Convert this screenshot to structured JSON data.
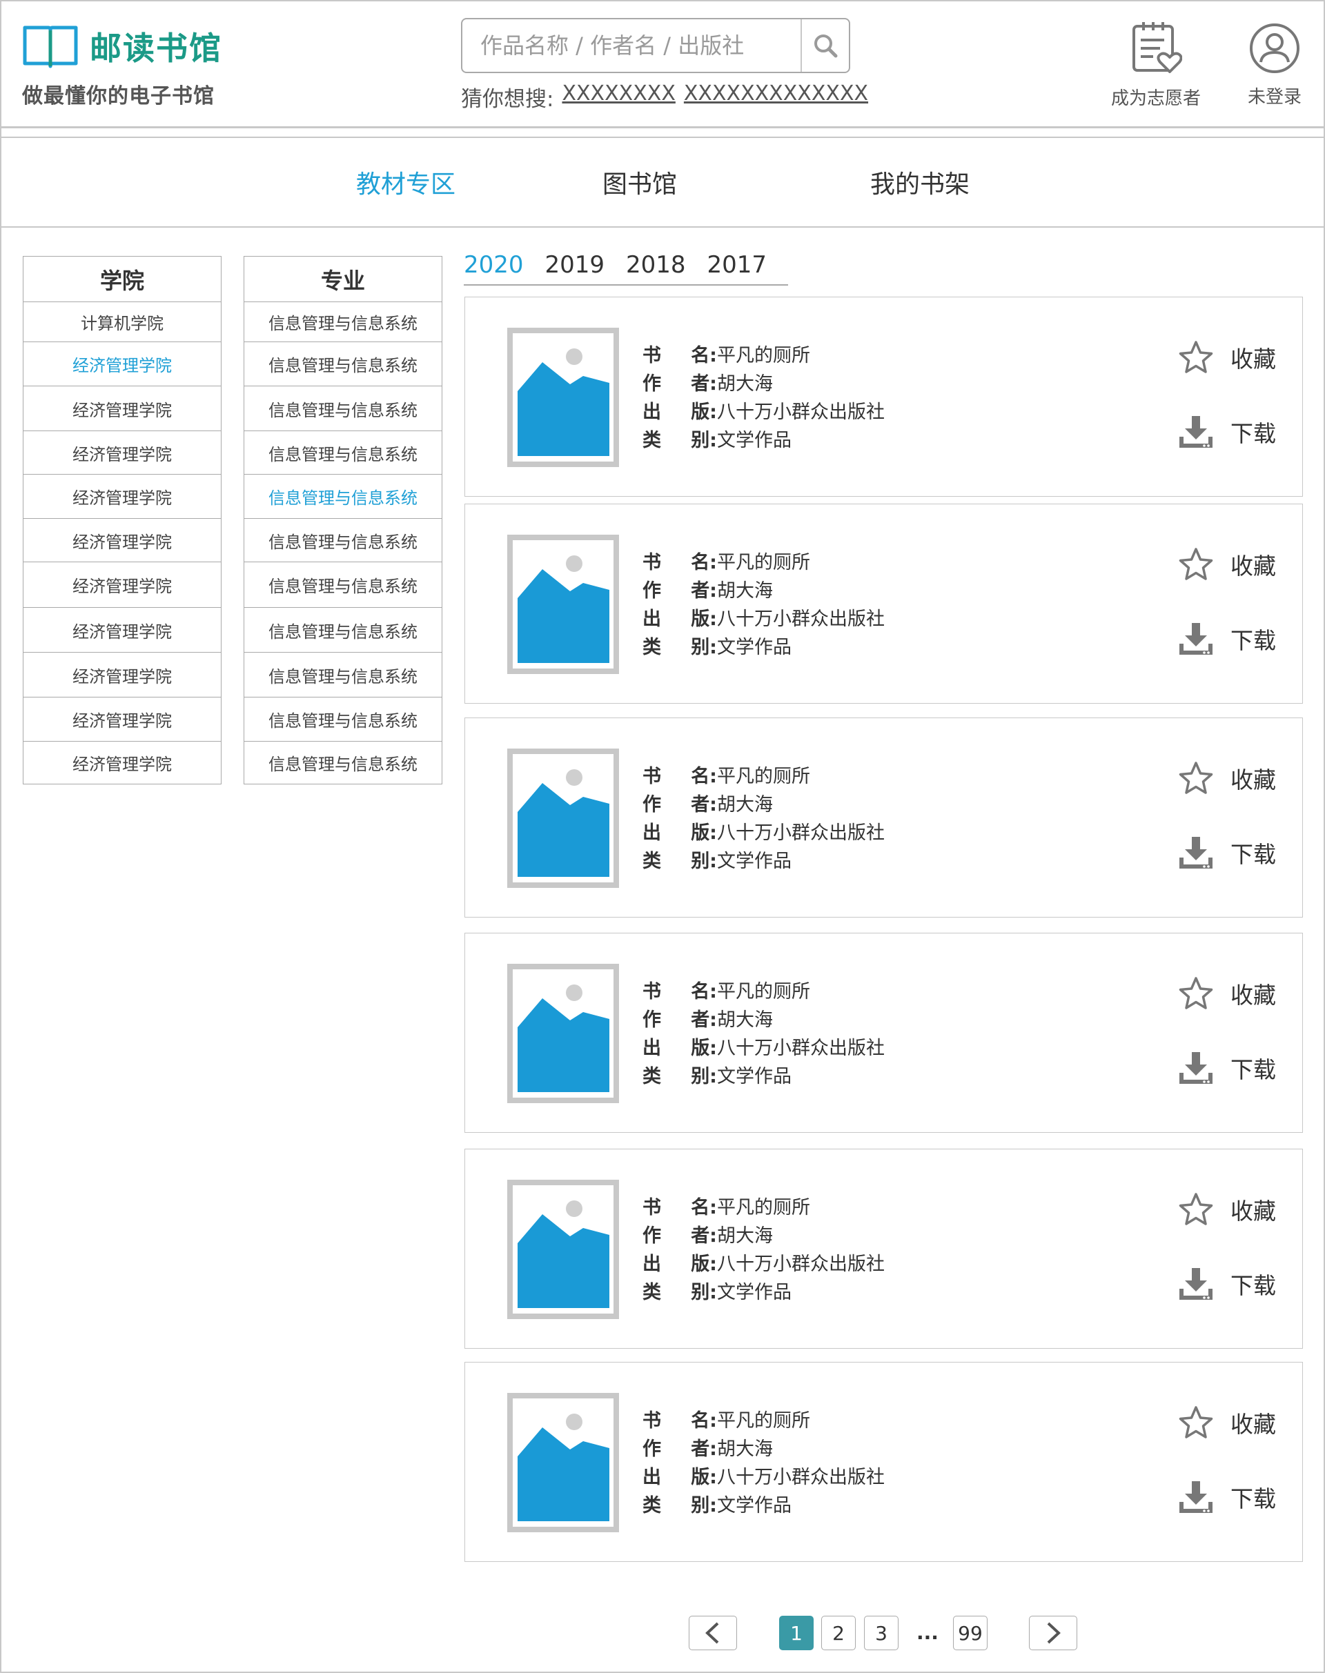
{
  "header": {
    "title": "邮读书馆",
    "slogan": "做最懂你的电子书馆",
    "search_placeholder": "作品名称 / 作者名 / 出版社",
    "hot_label": "猜你想搜:",
    "hot_links": [
      "XXXXXXXX",
      "XXXXXXXXXXXXX"
    ],
    "volunteer_label": "成为志愿者",
    "login_label": "未登录"
  },
  "nav": {
    "items": [
      "教材专区",
      "图书馆",
      "我的书架"
    ],
    "active": "教材专区"
  },
  "colleges": {
    "header": "学院",
    "items": [
      "计算机学院",
      "经济管理学院",
      "经济管理学院",
      "经济管理学院",
      "经济管理学院",
      "经济管理学院",
      "经济管理学院",
      "经济管理学院",
      "经济管理学院",
      "经济管理学院",
      "经济管理学院"
    ],
    "active_index": 1
  },
  "majors": {
    "header": "专业",
    "items": [
      "信息管理与信息系统",
      "信息管理与信息系统",
      "信息管理与信息系统",
      "信息管理与信息系统",
      "信息管理与信息系统",
      "信息管理与信息系统",
      "信息管理与信息系统",
      "信息管理与信息系统",
      "信息管理与信息系统",
      "信息管理与信息系统",
      "信息管理与信息系统"
    ],
    "active_index": 4
  },
  "years": {
    "items": [
      "2020",
      "2019",
      "2018",
      "2017"
    ],
    "active": "2020"
  },
  "book_labels": {
    "name": [
      "书",
      "名:"
    ],
    "author": [
      "作",
      "者:"
    ],
    "publisher": [
      "出",
      "版:"
    ],
    "category": [
      "类",
      "别:"
    ],
    "favorite": "收藏",
    "download": "下载"
  },
  "books": [
    {
      "name": "平凡的厕所",
      "author": "胡大海",
      "publisher": "八十万小群众出版社",
      "category": "文学作品"
    },
    {
      "name": "平凡的厕所",
      "author": "胡大海",
      "publisher": "八十万小群众出版社",
      "category": "文学作品"
    },
    {
      "name": "平凡的厕所",
      "author": "胡大海",
      "publisher": "八十万小群众出版社",
      "category": "文学作品"
    },
    {
      "name": "平凡的厕所",
      "author": "胡大海",
      "publisher": "八十万小群众出版社",
      "category": "文学作品"
    },
    {
      "name": "平凡的厕所",
      "author": "胡大海",
      "publisher": "八十万小群众出版社",
      "category": "文学作品"
    },
    {
      "name": "平凡的厕所",
      "author": "胡大海",
      "publisher": "八十万小群众出版社",
      "category": "文学作品"
    }
  ],
  "pagination": {
    "prev_icon": "chevron-left-icon",
    "next_icon": "chevron-right-icon",
    "pages": [
      "1",
      "2",
      "3",
      "99"
    ],
    "ellipsis": "...",
    "current": "1"
  },
  "colors": {
    "brand": "#1b9a87",
    "accent": "#20a0d6",
    "page_active": "#3a9aa6",
    "cover_blue": "#1a9ad6"
  }
}
